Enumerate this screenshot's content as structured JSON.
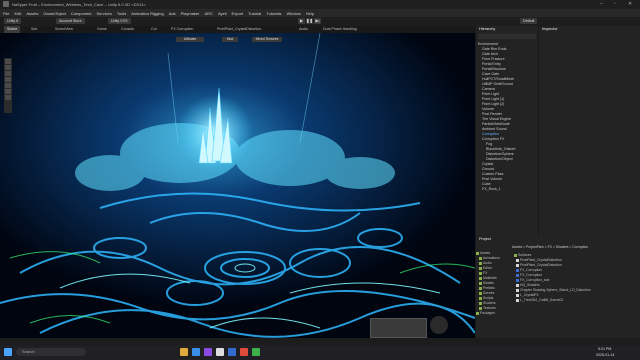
{
  "window": {
    "title": "NaSyper Fruit – Environment_Wireless_Tech_Cave – Unity 6.0.3f1 <DX11>"
  },
  "menu": [
    "File",
    "Edit",
    "Assets",
    "GameObject",
    "Component",
    "Services",
    "Tools",
    "Animation Rigging",
    "Ads",
    "Playmaker",
    "ARC",
    "Ayell",
    "Export",
    "Tutorial",
    "Tutorials",
    "Window",
    "Help"
  ],
  "toolbar": {
    "account": "Unity 6",
    "cloud": "Account Store",
    "version": "Unity VCS",
    "layout": "Default",
    "play": "▶",
    "pause": "❚❚",
    "step": "▶|"
  },
  "tabs": [
    "Scene",
    "Sub",
    "SceneView",
    "Game",
    "Console",
    "Cut",
    "FX Corruption",
    "PixelPlant_CrystalDistortion",
    "Audio",
    "Dual Phase Handling"
  ],
  "scene_overlay": [
    "Ultimate",
    "Mod",
    "Mixed Textures"
  ],
  "hierarchy": {
    "title": "Hierarchy",
    "items": [
      "Environment",
      "Gate Rim Ends",
      "Gate Arch",
      "Floor Fracture",
      "Portal Entry",
      "PortalStructure",
      "Cave Gate",
      "HullPCT/SmallMesh",
      "UtilMP Orbit/Sound",
      "Camera",
      "Point Light",
      "Point Light (1)",
      "Point Light (2)",
      "Volume",
      "Post Render",
      "The Visual Engine",
      "ParticleSetsNode",
      "Ambient Sound",
      "Corruption",
      "Corruption FX",
      "Fog",
      "BlackHole_Disturb",
      "Distortion/Sphere",
      "Distortion/Object",
      "Crystal",
      "Ground",
      "Custom Pass",
      "Post Volume",
      "Cube",
      "FX_Rock_1"
    ]
  },
  "inspector": {
    "title": "Inspector"
  },
  "project": {
    "title": "Project",
    "breadcrumb": "Assets > ProjectFiles > FX > Shaders > Corruption",
    "tree": [
      "Assets",
      "Animations",
      "Audio",
      "Editor",
      "FX",
      "Materials",
      "Models",
      "Prefabs",
      "Scenes",
      "Scripts",
      "Shaders",
      "Textures",
      "Packages"
    ],
    "files": [
      "Surfaces",
      "PixelPlant_CrystalDistortion",
      "PixelPlant_CrystalDistortion",
      "FX_Corruption",
      "FX_Corruption",
      "FX_Corruption_sub",
      "HQ_Shaders",
      "Chapter Shading Sphere_Stand_LO_Distortion",
      "L_CrystalFX",
      "L_TreeOBJ_Outlift_Scene02"
    ]
  },
  "taskbar": {
    "search": "Search",
    "time": "5:21 PM",
    "date": "2025-01-14"
  },
  "colors": {
    "accent": "#2b5bb8",
    "scene_bg": "#000510",
    "cyan_glow": "#3fd0ff",
    "folder": "#8ab04a"
  }
}
